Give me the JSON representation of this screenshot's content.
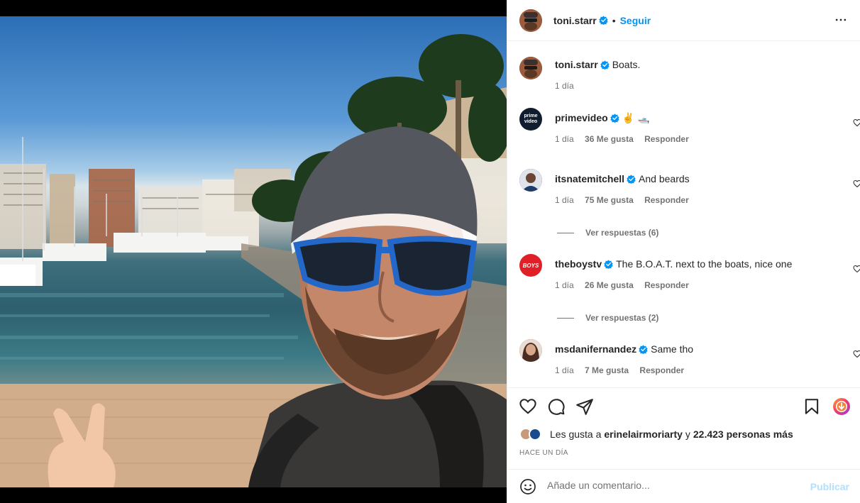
{
  "post": {
    "author": "toni.starr",
    "follow_label": "Seguir",
    "separator": "•",
    "caption": {
      "username": "toni.starr",
      "text": "Boats.",
      "time": "1 día"
    }
  },
  "comments": [
    {
      "username": "primevideo",
      "text": "✌️ 🛥️",
      "time": "1 día",
      "likes": "36 Me gusta",
      "reply_label": "Responder",
      "avatar_label": "prime video",
      "avatar_color": "#0f1d2e"
    },
    {
      "username": "itsnatemitchell",
      "text": "And beards",
      "time": "1 día",
      "likes": "75 Me gusta",
      "reply_label": "Responder",
      "avatar_color": "#2b4a7a"
    },
    {
      "username": "theboystv",
      "text": "The B.O.A.T. next to the boats, nice one",
      "time": "1 día",
      "likes": "26 Me gusta",
      "reply_label": "Responder",
      "avatar_label": "BOYS",
      "avatar_color": "#e01f26"
    },
    {
      "username": "msdanifernandez",
      "text": "Same tho",
      "time": "1 día",
      "likes": "7 Me gusta",
      "reply_label": "Responder",
      "avatar_color": "#8a5a45"
    }
  ],
  "view_replies": [
    {
      "label": "Ver respuestas (6)"
    },
    {
      "label": "Ver respuestas (2)"
    }
  ],
  "likes": {
    "prefix": "Les gusta a",
    "first_user": "erinelairmoriarty",
    "joiner": "y",
    "others": "22.423 personas más"
  },
  "time_ago": "HACE UN DÍA",
  "add_comment": {
    "placeholder": "Añade un comentario...",
    "publish_label": "Publicar"
  },
  "icons": {
    "like": "heart-icon",
    "comment": "comment-icon",
    "share": "send-icon",
    "save": "bookmark-icon",
    "more": "more-icon",
    "emoji": "emoji-icon",
    "verified": "verified-badge-icon"
  },
  "colors": {
    "accent": "#0095f6",
    "publish_disabled": "#b2dffc",
    "verified": "#0095f6"
  }
}
